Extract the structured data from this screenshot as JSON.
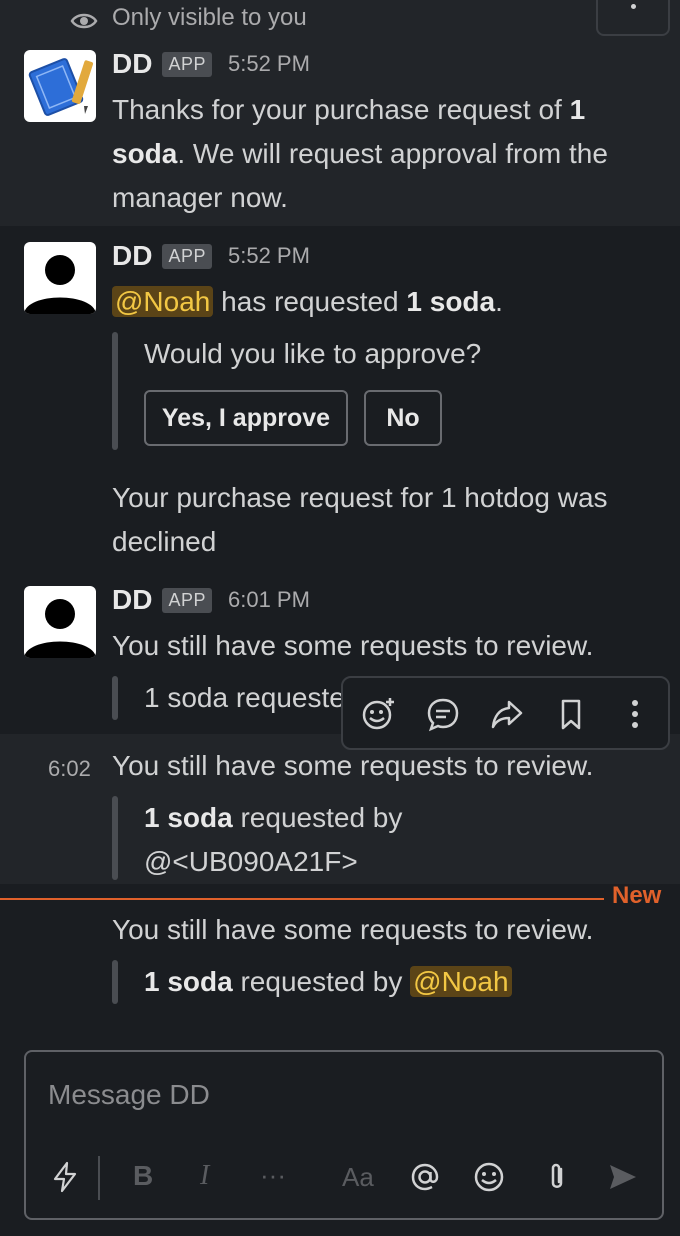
{
  "top_notice": {
    "icon": "eye-icon",
    "text": "Only visible to you"
  },
  "messages": [
    {
      "name": "DD",
      "badge": "APP",
      "time": "5:52 PM",
      "text_parts": [
        "Thanks for your purchase request of ",
        "1 soda",
        ". We will request approval from the manager now."
      ]
    },
    {
      "name": "DD",
      "badge": "APP",
      "time": "5:52 PM",
      "mention": "@Noah",
      "text_mid": " has requested ",
      "text_bold": "1 soda",
      "text_end": ".",
      "quote": "Would you like to approve?",
      "buttons": {
        "approve": "Yes, I approve",
        "decline": "No"
      },
      "followup": "Your purchase request for 1 hotdog was declined"
    },
    {
      "name": "DD",
      "badge": "APP",
      "time": "6:01 PM",
      "text": "You still have some requests to review.",
      "quote": "1 soda requested by"
    },
    {
      "time_short": "6:02",
      "text": "You still have some requests to review.",
      "quote_bold": "1 soda",
      "quote_rest": " requested by",
      "quote_line2": "@<UB090A21F>"
    },
    {
      "text": "You still have some requests to review.",
      "quote_bold": "1 soda",
      "quote_rest": " requested by ",
      "mention": "@Noah"
    }
  ],
  "new_divider": "New",
  "composer": {
    "placeholder": "Message DD",
    "icons": [
      "lightning-icon",
      "bold-icon",
      "italic-icon",
      "more-icon",
      "text-format-icon",
      "mention-icon",
      "emoji-icon",
      "attach-icon",
      "send-icon"
    ],
    "bold_label": "B",
    "italic_label": "I",
    "more_label": "···",
    "format_label": "Aa"
  },
  "toolbar_icons": [
    "add-reaction-icon",
    "reply-thread-icon",
    "share-icon",
    "bookmark-icon",
    "more-actions-icon"
  ],
  "colors": {
    "background": "#1a1d21",
    "highlight": "#222529",
    "mention_bg": "#5b4417",
    "mention_text": "#f2c744",
    "new_divider": "#e0612b"
  }
}
